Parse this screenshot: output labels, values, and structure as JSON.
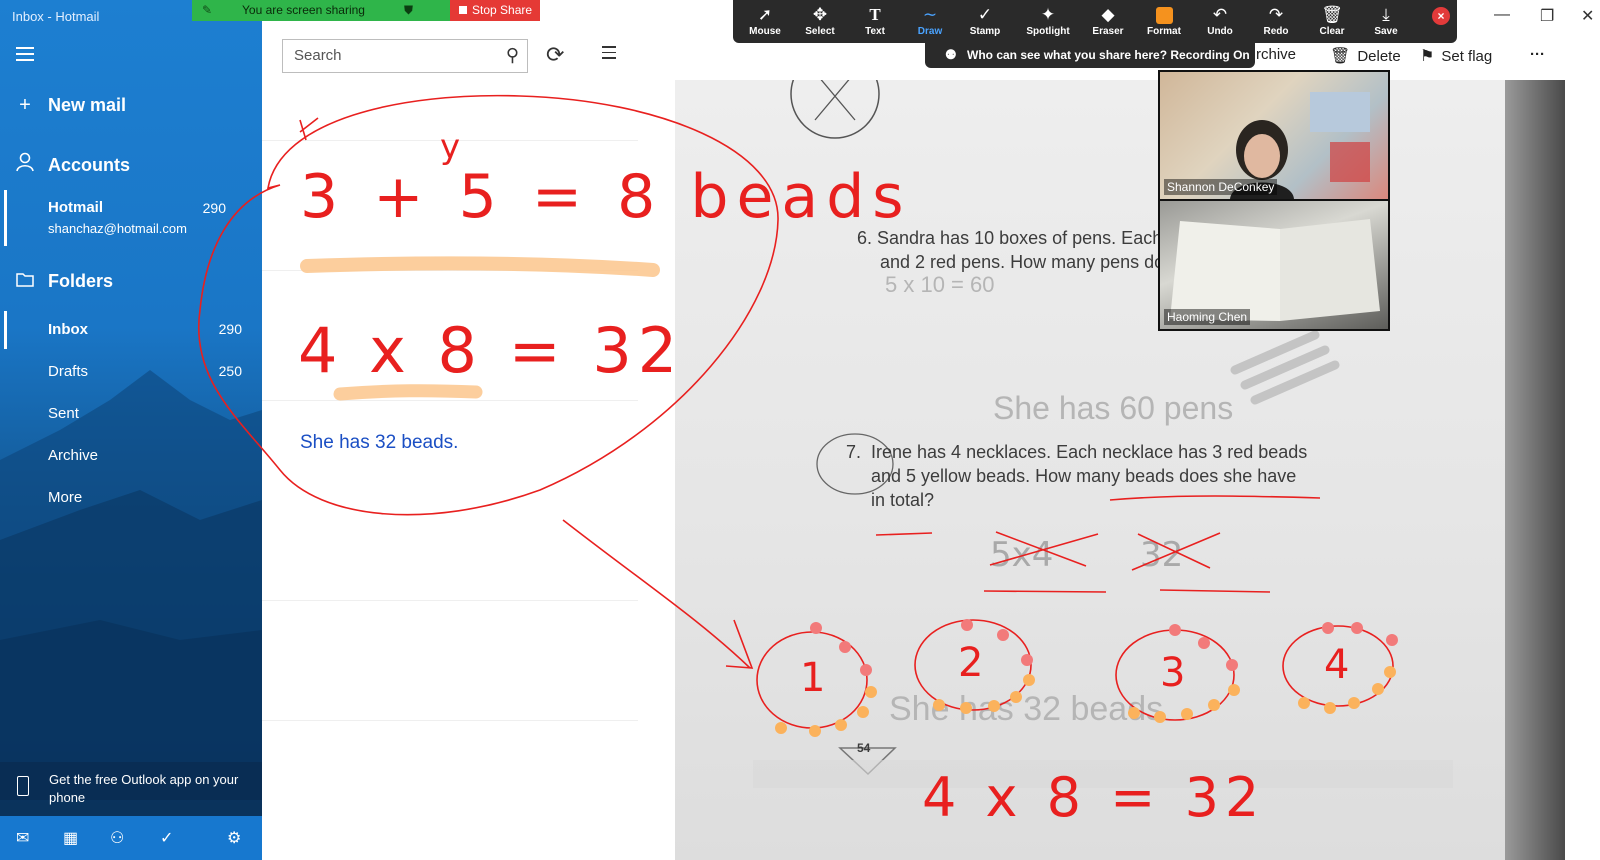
{
  "window": {
    "title": "Inbox - Hotmail"
  },
  "sidebar": {
    "new_mail": "New mail",
    "accounts": "Accounts",
    "account": {
      "name": "Hotmail",
      "email": "shanchaz@hotmail.com",
      "count": "290"
    },
    "folders_label": "Folders",
    "folders": [
      {
        "name": "Inbox",
        "count": "290"
      },
      {
        "name": "Drafts",
        "count": "250"
      },
      {
        "name": "Sent",
        "count": ""
      },
      {
        "name": "Archive",
        "count": ""
      },
      {
        "name": "More",
        "count": ""
      }
    ],
    "promo": "Get the free Outlook app on your phone"
  },
  "list": {
    "search_placeholder": "Search",
    "reply_text": "She has 32 beads."
  },
  "reading": {
    "commands": [
      "rchive",
      "Delete",
      "Set flag",
      "···"
    ]
  },
  "share": {
    "status": "You are screen sharing",
    "stop": "Stop Share",
    "recording": "Who can see what you share here? Recording On"
  },
  "zoom_toolbar": {
    "tools": [
      "Mouse",
      "Select",
      "Text",
      "Draw",
      "Stamp",
      "Spotlight",
      "Eraser",
      "Format",
      "Undo",
      "Redo",
      "Clear",
      "Save"
    ],
    "active": "Draw",
    "format_color": "#f5921e"
  },
  "participants": [
    {
      "name": "Shannon DeConkey"
    },
    {
      "name": "Haoming Chen"
    }
  ],
  "worksheet": {
    "q6_line1": "6.  Sandra has 10 boxes of pens. Each b",
    "q6_line2": "and 2 red pens. How many pens do",
    "q6_work": "5 x 10 = 60",
    "q7_num": "7.",
    "q7_line1": "Irene has 4 necklaces. Each necklace has 3 red beads",
    "q7_line2": "and 5 yellow beads. How many beads does she have",
    "q7_line3": "in total?",
    "page_number": "54",
    "pencil_1": "She has 60 pens",
    "pencil_2": "She has 32 beads"
  },
  "annotations": {
    "eq1": "3 + 5 = 8 beads",
    "eq2": "4 x 8 = 32",
    "eq3": "4 x 8 = 32",
    "circled_numbers": [
      "1",
      "2",
      "3",
      "4"
    ],
    "ink_color": "#e8201f",
    "highlight_color": "#fbc58c"
  }
}
